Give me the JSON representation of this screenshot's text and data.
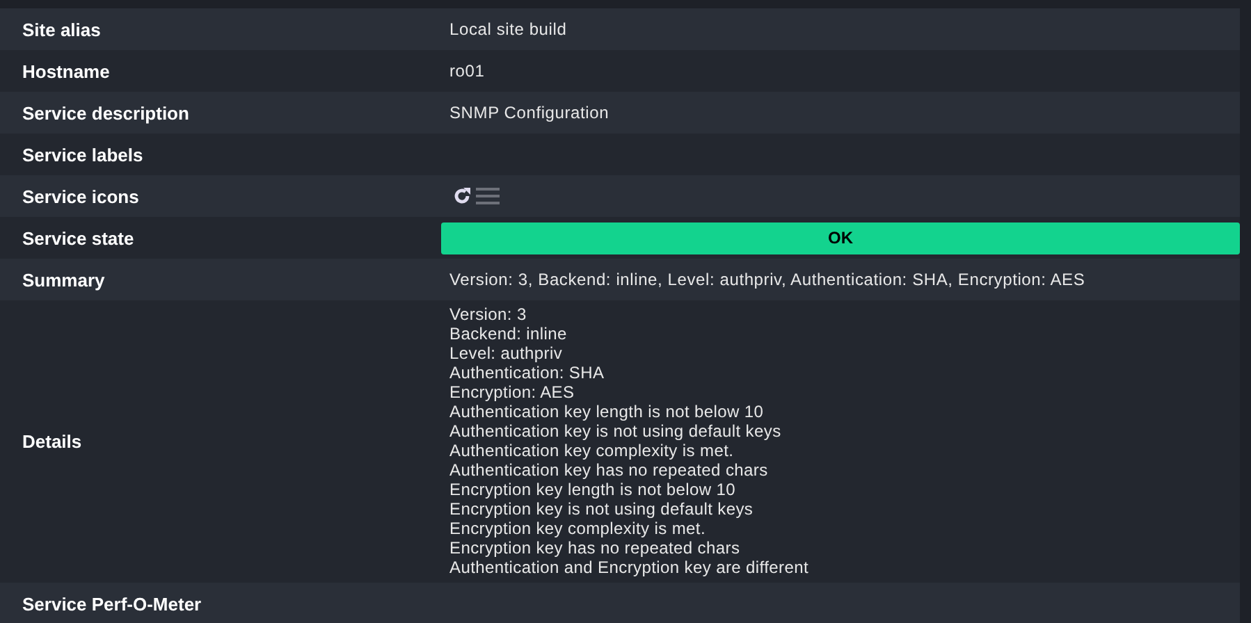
{
  "rows": [
    {
      "label": "Site alias",
      "kind": "text",
      "value": "Local site build"
    },
    {
      "label": "Hostname",
      "kind": "text",
      "value": "ro01"
    },
    {
      "label": "Service description",
      "kind": "text",
      "value": "SNMP Configuration"
    },
    {
      "label": "Service labels",
      "kind": "empty"
    },
    {
      "label": "Service icons",
      "kind": "icons"
    },
    {
      "label": "Service state",
      "kind": "state",
      "value": "OK",
      "color": "#13d38e"
    },
    {
      "label": "Summary",
      "kind": "text",
      "value": "Version: 3, Backend: inline, Level: authpriv, Authentication: SHA, Encryption: AES"
    },
    {
      "label": "Details",
      "kind": "lines",
      "lines": [
        "Version: 3",
        "Backend: inline",
        "Level: authpriv",
        "Authentication: SHA",
        "Encryption: AES",
        "Authentication key length is not below 10",
        "Authentication key is not using default keys",
        "Authentication key complexity is met.",
        "Authentication key has no repeated chars",
        "Encryption key length is not below 10",
        "Encryption key is not using default keys",
        "Encryption key complexity is met.",
        "Encryption key has no repeated chars",
        "Authentication and Encryption key are different"
      ]
    },
    {
      "label": "Service Perf-O-Meter",
      "kind": "empty"
    }
  ]
}
